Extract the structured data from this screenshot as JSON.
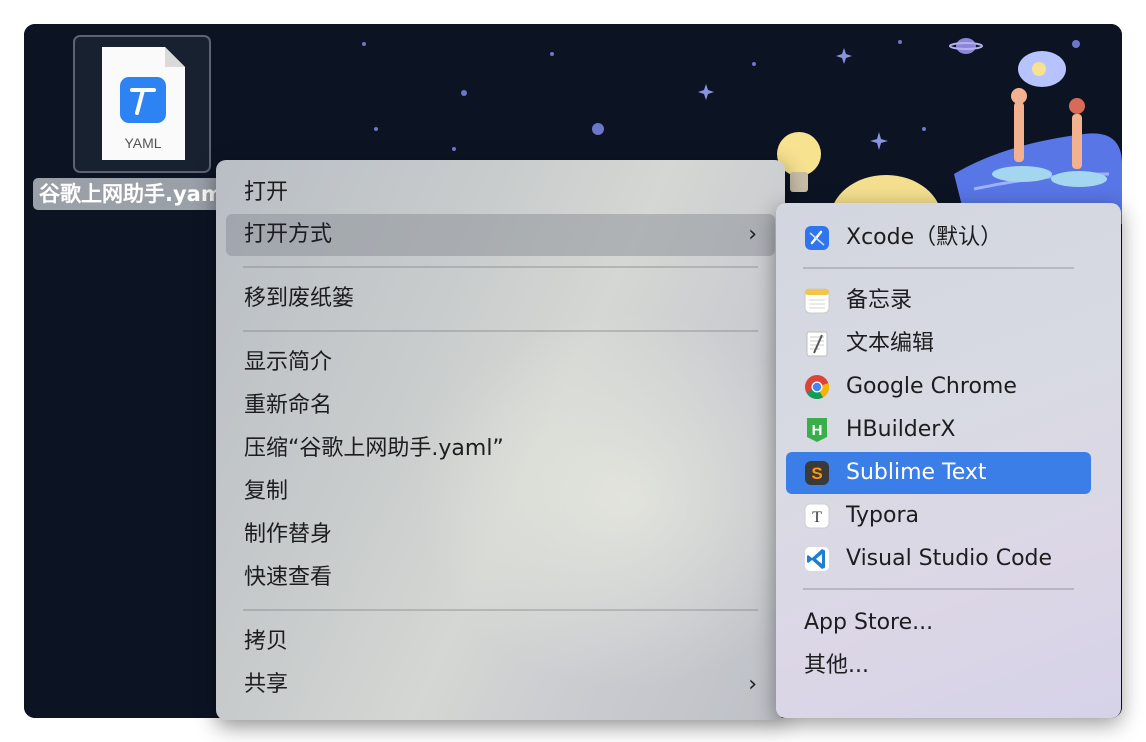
{
  "desktop": {
    "file": {
      "type_label": "YAML",
      "name": "谷歌上网助手.yaml"
    }
  },
  "context_menu": {
    "items": [
      {
        "label": "打开"
      },
      {
        "label": "打开方式",
        "has_submenu": true,
        "highlighted": true
      },
      {
        "label": "移到废纸篓"
      },
      {
        "label": "显示简介"
      },
      {
        "label": "重新命名"
      },
      {
        "label": "压缩“谷歌上网助手.yaml”"
      },
      {
        "label": "复制"
      },
      {
        "label": "制作替身"
      },
      {
        "label": "快速查看"
      },
      {
        "label": "拷贝"
      },
      {
        "label": "共享",
        "has_submenu": true
      }
    ],
    "chevron": "›"
  },
  "open_with_submenu": {
    "apps": [
      {
        "label": "Xcode（默认）",
        "icon": "xcode-icon"
      },
      {
        "label": "备忘录",
        "icon": "notes-icon"
      },
      {
        "label": "文本编辑",
        "icon": "textedit-icon"
      },
      {
        "label": "Google Chrome",
        "icon": "chrome-icon"
      },
      {
        "label": "HBuilderX",
        "icon": "hbuilderx-icon",
        "icon_letter": "H"
      },
      {
        "label": "Sublime Text",
        "icon": "sublime-icon",
        "icon_letter": "S",
        "selected": true
      },
      {
        "label": "Typora",
        "icon": "typora-icon",
        "icon_letter": "T"
      },
      {
        "label": "Visual Studio Code",
        "icon": "vscode-icon"
      }
    ],
    "extra": [
      {
        "label": "App Store..."
      },
      {
        "label": "其他..."
      }
    ]
  },
  "colors": {
    "selection": "#3b7ee8",
    "desktop": "#0c1424"
  }
}
